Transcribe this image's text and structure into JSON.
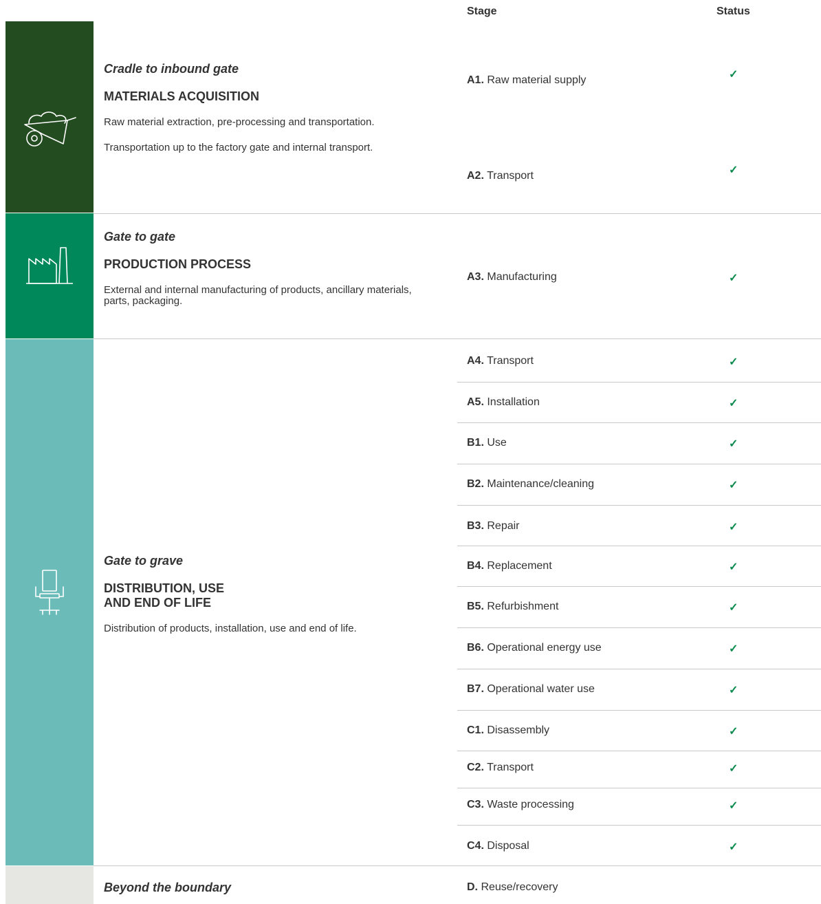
{
  "header": {
    "stage": "Stage",
    "status": "Status"
  },
  "colors": {
    "band1": "#234d20",
    "band2": "#00875a",
    "band3": "#6bbcb9",
    "band4": "#e6e6e3",
    "check": "#0a8a4d"
  },
  "sections": [
    {
      "icon": "wheelbarrow-icon",
      "phase": "Cradle to inbound gate",
      "title": "MATERIALS ACQUISITION",
      "desc": "Raw material extraction, pre-processing and transportation.",
      "desc2": "Transportation up to the factory gate and internal transport."
    },
    {
      "icon": "factory-icon",
      "phase": "Gate to gate",
      "title": "PRODUCTION PROCESS",
      "desc": "External and internal manufacturing of products, ancillary materials, parts, packaging."
    },
    {
      "icon": "office-chair-icon",
      "phase": "Gate to grave",
      "title_line1": "DISTRIBUTION, USE",
      "title_line2": "AND END OF LIFE",
      "desc": "Distribution of products, installation, use and end of life."
    },
    {
      "phase": "Beyond the boundary"
    }
  ],
  "stages": [
    {
      "code": "A1.",
      "label": "Raw material supply",
      "status": "✓"
    },
    {
      "code": "A2.",
      "label": "Transport",
      "status": "✓"
    },
    {
      "code": "A3.",
      "label": "Manufacturing",
      "status": "✓"
    },
    {
      "code": "A4.",
      "label": "Transport",
      "status": "✓"
    },
    {
      "code": "A5.",
      "label": "Installation",
      "status": "✓"
    },
    {
      "code": "B1.",
      "label": "Use",
      "status": "✓"
    },
    {
      "code": "B2.",
      "label": "Maintenance/cleaning",
      "status": "✓"
    },
    {
      "code": "B3.",
      "label": "Repair",
      "status": "✓"
    },
    {
      "code": "B4.",
      "label": "Replacement",
      "status": "✓"
    },
    {
      "code": "B5.",
      "label": "Refurbishment",
      "status": "✓"
    },
    {
      "code": "B6.",
      "label": "Operational energy use",
      "status": "✓"
    },
    {
      "code": "B7.",
      "label": "Operational water use",
      "status": "✓"
    },
    {
      "code": "C1.",
      "label": "Disassembly",
      "status": "✓"
    },
    {
      "code": "C2.",
      "label": "Transport",
      "status": "✓"
    },
    {
      "code": "C3.",
      "label": "Waste processing",
      "status": "✓"
    },
    {
      "code": "C4.",
      "label": "Disposal",
      "status": "✓"
    },
    {
      "code": "D.",
      "label": "Reuse/recovery"
    }
  ]
}
